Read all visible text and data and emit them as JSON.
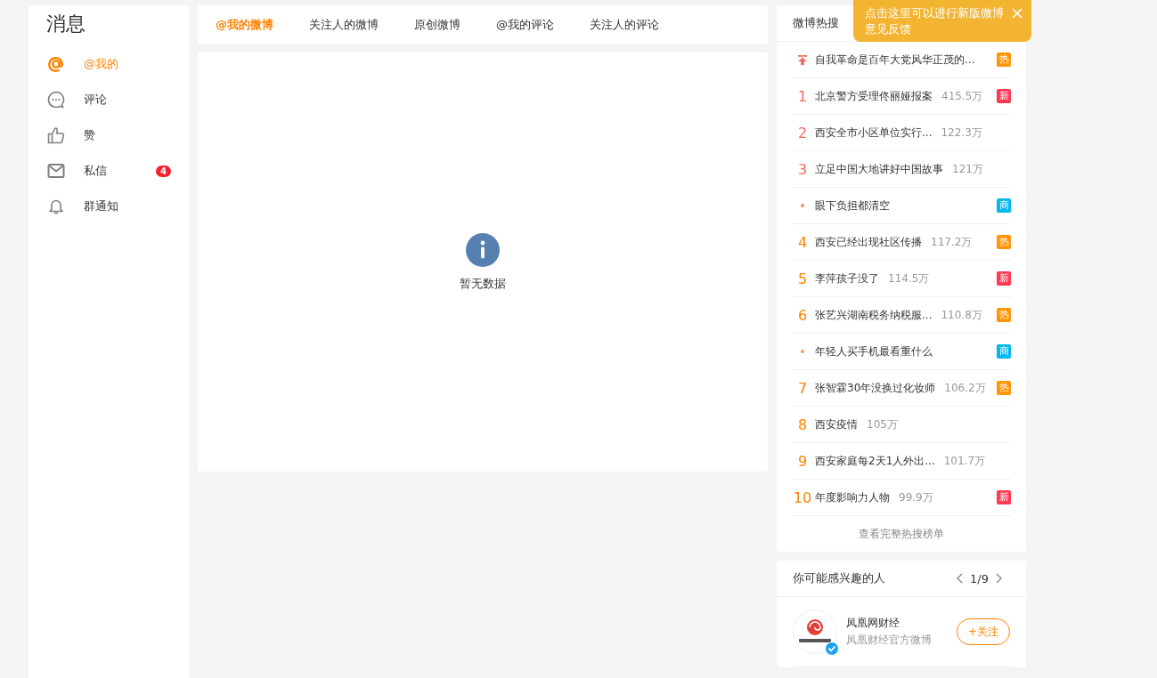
{
  "sidebar": {
    "title": "消息",
    "items": [
      {
        "label": "@我的",
        "kind": "at",
        "selected": true
      },
      {
        "label": "评论",
        "kind": "comment",
        "selected": false
      },
      {
        "label": "赞",
        "kind": "like",
        "selected": false
      },
      {
        "label": "私信",
        "kind": "mail",
        "selected": false,
        "badge": "4"
      },
      {
        "label": "群通知",
        "kind": "bell",
        "selected": false
      }
    ]
  },
  "tabs": [
    {
      "label": "@我的微博",
      "selected": true
    },
    {
      "label": "关注人的微博",
      "selected": false
    },
    {
      "label": "原创微博",
      "selected": false
    },
    {
      "label": "@我的评论",
      "selected": false
    },
    {
      "label": "关注人的评论",
      "selected": false
    }
  ],
  "empty_state": {
    "message": "暂无数据"
  },
  "hot_search": {
    "title": "微博热搜",
    "items": [
      {
        "kind": "pinned",
        "title": "自我革命是百年大党风华正茂的...",
        "tag": {
          "label": "热",
          "color": "#ff9406"
        }
      },
      {
        "kind": "ranked",
        "rank": "1",
        "color": "#f26d5f",
        "title": "北京警方受理佟丽娅报案",
        "count": "415.5万",
        "tag": {
          "label": "新",
          "color": "#ff3852"
        }
      },
      {
        "kind": "ranked",
        "rank": "2",
        "color": "#f26d5f",
        "title": "西安全市小区单位实行...",
        "count": "122.3万"
      },
      {
        "kind": "ranked",
        "rank": "3",
        "color": "#f26d5f",
        "title": "立足中国大地讲好中国故事",
        "count": "121万"
      },
      {
        "kind": "promoted",
        "title": "眼下负担都清空",
        "tag": {
          "label": "商",
          "color": "#00b7ee"
        }
      },
      {
        "kind": "ranked",
        "rank": "4",
        "color": "#ff8200",
        "title": "西安已经出现社区传播",
        "count": "117.2万",
        "tag": {
          "label": "热",
          "color": "#ff9406"
        }
      },
      {
        "kind": "ranked",
        "rank": "5",
        "color": "#ff8200",
        "title": "李萍孩子没了",
        "count": "114.5万",
        "tag": {
          "label": "新",
          "color": "#ff3852"
        }
      },
      {
        "kind": "ranked",
        "rank": "6",
        "color": "#ff8200",
        "title": "张艺兴湖南税务纳税服...",
        "count": "110.8万",
        "tag": {
          "label": "热",
          "color": "#ff9406"
        }
      },
      {
        "kind": "promoted",
        "title": "年轻人买手机最看重什么",
        "tag": {
          "label": "商",
          "color": "#00b7ee"
        }
      },
      {
        "kind": "ranked",
        "rank": "7",
        "color": "#ff8200",
        "title": "张智霖30年没换过化妆师",
        "count": "106.2万",
        "tag": {
          "label": "热",
          "color": "#ff9406"
        }
      },
      {
        "kind": "ranked",
        "rank": "8",
        "color": "#ff8200",
        "title": "西安疫情",
        "count": "105万"
      },
      {
        "kind": "ranked",
        "rank": "9",
        "color": "#ff8200",
        "title": "西安家庭每2天1人外出...",
        "count": "101.7万"
      },
      {
        "kind": "ranked",
        "rank": "10",
        "color": "#ff8200",
        "title": "年度影响力人物",
        "count": "99.9万",
        "tag": {
          "label": "新",
          "color": "#ff3852"
        }
      }
    ],
    "more_link": "查看完整热搜榜单"
  },
  "feedback_tip": {
    "text": "点击这里可以进行新版微博意见反馈"
  },
  "suggested_people": {
    "title": "你可能感兴趣的人",
    "pager": "1/9",
    "people": [
      {
        "name": "凤凰网财经",
        "description": "凤凰财经官方微博",
        "verified": true,
        "follow_label": "+关注"
      }
    ]
  }
}
